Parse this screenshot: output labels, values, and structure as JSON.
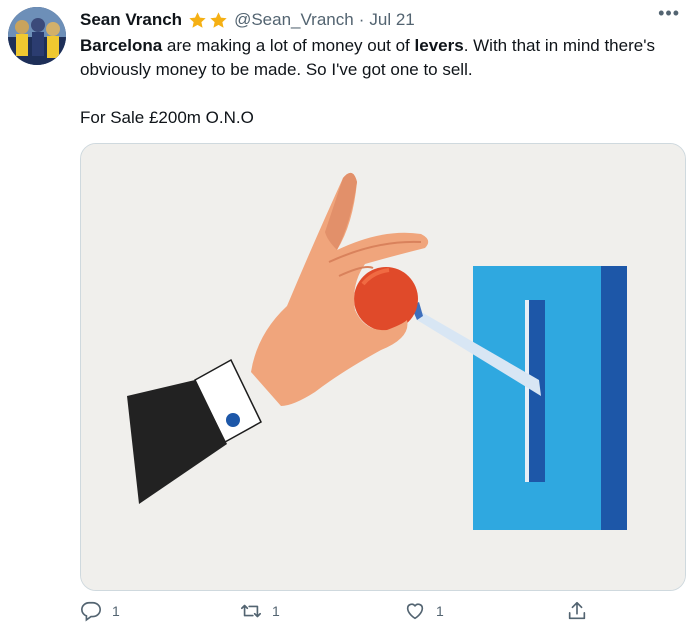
{
  "tweet": {
    "author_name": "Sean Vranch",
    "handle": "@Sean_Vranch",
    "separator": "·",
    "date": "Jul 21",
    "more": "•••",
    "text": {
      "bold_1": "Barcelona",
      "part_1": " are making a lot of money out of ",
      "bold_2": "levers",
      "part_2": ". With that in mind there's obviously money to be made. So I've got one to sell.",
      "line_2": "For Sale £200m O.N.O"
    },
    "stars_icon": "star-icon",
    "colors": {
      "star": "#f5b014",
      "secondary_text": "#536471",
      "media_bg": "#f0efec",
      "panel_light": "#2fa8e0",
      "panel_dark": "#1d57a8",
      "knob": "#e04a2a",
      "skin": "#f0a57c",
      "sleeve": "#222222"
    }
  },
  "actions": {
    "reply": {
      "icon": "reply-icon",
      "count": "1"
    },
    "retweet": {
      "icon": "retweet-icon",
      "count": "1"
    },
    "like": {
      "icon": "heart-icon",
      "count": "1"
    },
    "share": {
      "icon": "share-icon"
    }
  }
}
